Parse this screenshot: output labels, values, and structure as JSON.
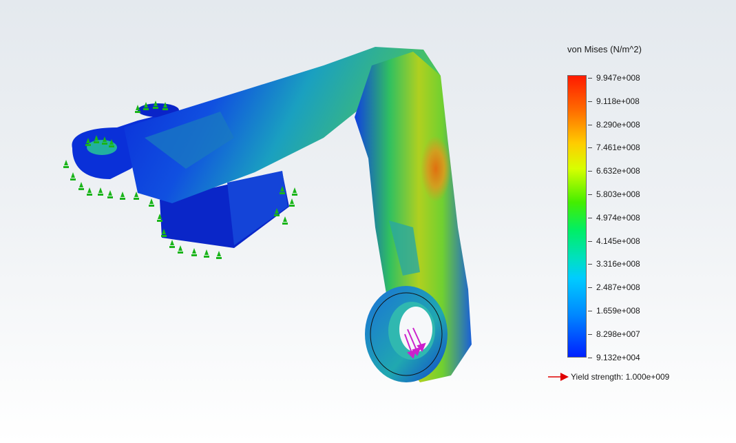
{
  "legend": {
    "title": "von Mises (N/m^2)",
    "ticks": [
      "9.947e+008",
      "9.118e+008",
      "8.290e+008",
      "7.461e+008",
      "6.632e+008",
      "5.803e+008",
      "4.974e+008",
      "4.145e+008",
      "3.316e+008",
      "2.487e+008",
      "1.659e+008",
      "8.298e+007",
      "9.132e+004"
    ],
    "colors": [
      "#ff1a00",
      "#ffcc00",
      "#44ee00",
      "#00e0c0",
      "#0088ff",
      "#0020ff"
    ]
  },
  "yield": {
    "label": "Yield strength:",
    "value": "1.000e+009",
    "arrow_color": "#e00000"
  },
  "icons": {
    "fixture": "fixture-arrow-icon",
    "load": "load-arrow-icon"
  }
}
